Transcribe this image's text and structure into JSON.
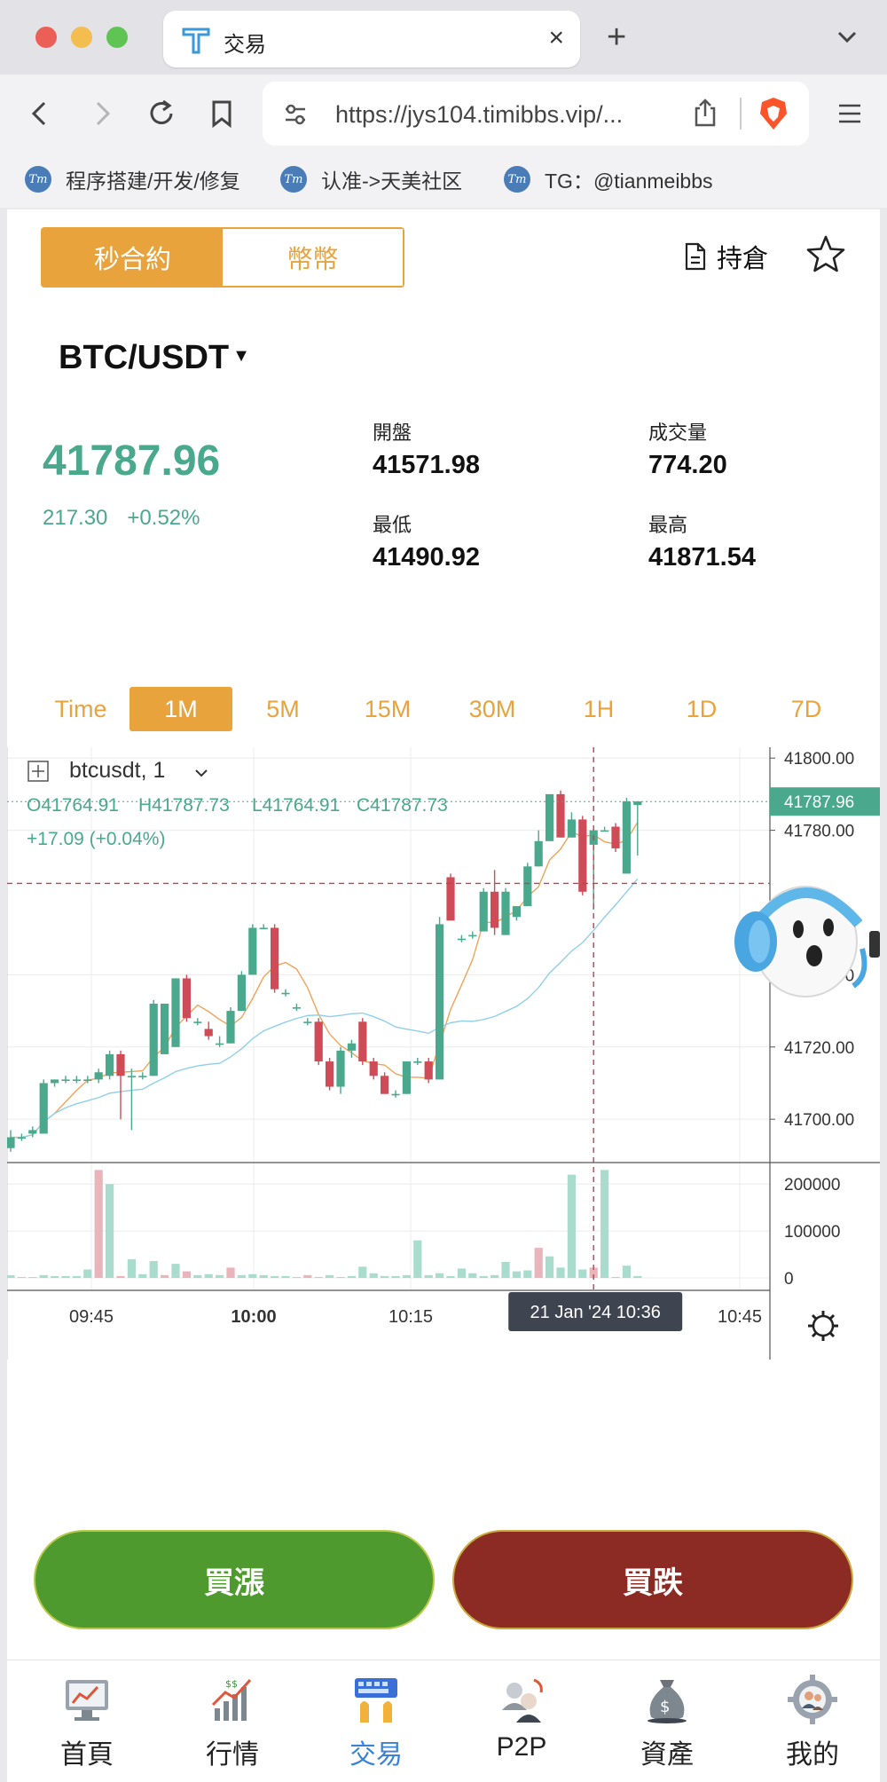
{
  "browser": {
    "tab_title": "交易",
    "url": "https://jys104.timibbs.vip/...",
    "bookmarks": [
      "程序搭建/开发/修复",
      "认准->天美社区",
      "TG：@tianmeibbs"
    ],
    "bookmark_logo": "Tm"
  },
  "header": {
    "segments": [
      "秒合約",
      "幣幣"
    ],
    "active_segment": "秒合約",
    "holdings_label": "持倉"
  },
  "ticker": {
    "pair": "BTC/USDT",
    "price": "41787.96",
    "change": "217.30",
    "change_pct": "+0.52%",
    "stats": [
      {
        "label": "開盤",
        "value": "41571.98"
      },
      {
        "label": "成交量",
        "value": "774.20"
      },
      {
        "label": "最低",
        "value": "41490.92"
      },
      {
        "label": "最高",
        "value": "41871.54"
      }
    ]
  },
  "timeframes": [
    "Time",
    "1M",
    "5M",
    "15M",
    "30M",
    "1H",
    "1D",
    "7D"
  ],
  "active_timeframe": "1M",
  "chart_legend": {
    "symbol": "btcusdt, 1",
    "o": "O41764.91",
    "h": "H41787.73",
    "l": "L41764.91",
    "c": "C41787.73",
    "change": "+17.09 (+0.04%)"
  },
  "chart_data": {
    "type": "candlestick",
    "symbol": "btcusdt",
    "interval": "1",
    "last_price": 41787.96,
    "price_axis": [
      "41800.00",
      "41780.00",
      "41740.00",
      "41720.00",
      "41700.00"
    ],
    "price_ylim": [
      41688,
      41803
    ],
    "volume_axis": [
      "200000",
      "100000",
      "0"
    ],
    "volume_ylim": [
      0,
      242000
    ],
    "time_axis": [
      "09:45",
      "10:00",
      "10:15",
      "10:45"
    ],
    "crosshair_label": "21 Jan '24   10:36",
    "colors": {
      "up": "#4aa88c",
      "down": "#cf4b57",
      "ma_fast": "#f0a25a",
      "ma_slow": "#8fd0e8"
    },
    "candles": [
      {
        "o": 41692,
        "h": 41697,
        "l": 41691,
        "c": 41695
      },
      {
        "o": 41695,
        "h": 41696,
        "l": 41694,
        "c": 41695
      },
      {
        "o": 41696,
        "h": 41698,
        "l": 41695,
        "c": 41697
      },
      {
        "o": 41696,
        "h": 41711,
        "l": 41696,
        "c": 41710
      },
      {
        "o": 41710,
        "h": 41711,
        "l": 41709,
        "c": 41711
      },
      {
        "o": 41711,
        "h": 41712,
        "l": 41710,
        "c": 41711
      },
      {
        "o": 41711,
        "h": 41712,
        "l": 41710,
        "c": 41711
      },
      {
        "o": 41711,
        "h": 41712,
        "l": 41710,
        "c": 41711
      },
      {
        "o": 41711,
        "h": 41714,
        "l": 41710,
        "c": 41713
      },
      {
        "o": 41712,
        "h": 41719,
        "l": 41711,
        "c": 41718
      },
      {
        "o": 41718,
        "h": 41719,
        "l": 41700,
        "c": 41712
      },
      {
        "o": 41712,
        "h": 41714,
        "l": 41697,
        "c": 41712
      },
      {
        "o": 41712,
        "h": 41713,
        "l": 41711,
        "c": 41712
      },
      {
        "o": 41712,
        "h": 41733,
        "l": 41712,
        "c": 41732
      },
      {
        "o": 41718,
        "h": 41732,
        "l": 41718,
        "c": 41732
      },
      {
        "o": 41720,
        "h": 41739,
        "l": 41720,
        "c": 41739
      },
      {
        "o": 41739,
        "h": 41740,
        "l": 41727,
        "c": 41728
      },
      {
        "o": 41727,
        "h": 41728,
        "l": 41726,
        "c": 41727
      },
      {
        "o": 41725,
        "h": 41727,
        "l": 41722,
        "c": 41723
      },
      {
        "o": 41721,
        "h": 41723,
        "l": 41720,
        "c": 41721
      },
      {
        "o": 41721,
        "h": 41731,
        "l": 41721,
        "c": 41730
      },
      {
        "o": 41730,
        "h": 41741,
        "l": 41730,
        "c": 41740
      },
      {
        "o": 41740,
        "h": 41754,
        "l": 41740,
        "c": 41753
      },
      {
        "o": 41753,
        "h": 41754,
        "l": 41753,
        "c": 41753
      },
      {
        "o": 41753,
        "h": 41754,
        "l": 41735,
        "c": 41736
      },
      {
        "o": 41735,
        "h": 41736,
        "l": 41734,
        "c": 41735
      },
      {
        "o": 41731,
        "h": 41732,
        "l": 41730,
        "c": 41731
      },
      {
        "o": 41727,
        "h": 41728,
        "l": 41726,
        "c": 41727
      },
      {
        "o": 41727,
        "h": 41728,
        "l": 41715,
        "c": 41716
      },
      {
        "o": 41716,
        "h": 41717,
        "l": 41708,
        "c": 41709
      },
      {
        "o": 41709,
        "h": 41720,
        "l": 41707,
        "c": 41719
      },
      {
        "o": 41719,
        "h": 41722,
        "l": 41717,
        "c": 41721
      },
      {
        "o": 41727,
        "h": 41728,
        "l": 41715,
        "c": 41716
      },
      {
        "o": 41716,
        "h": 41717,
        "l": 41711,
        "c": 41712
      },
      {
        "o": 41712,
        "h": 41713,
        "l": 41707,
        "c": 41707
      },
      {
        "o": 41707,
        "h": 41708,
        "l": 41706,
        "c": 41707
      },
      {
        "o": 41707,
        "h": 41716,
        "l": 41707,
        "c": 41716
      },
      {
        "o": 41716,
        "h": 41717,
        "l": 41715,
        "c": 41716
      },
      {
        "o": 41716,
        "h": 41717,
        "l": 41710,
        "c": 41711
      },
      {
        "o": 41711,
        "h": 41756,
        "l": 41711,
        "c": 41754
      },
      {
        "o": 41767,
        "h": 41768,
        "l": 41756,
        "c": 41755
      },
      {
        "o": 41750,
        "h": 41751,
        "l": 41749,
        "c": 41750
      },
      {
        "o": 41751,
        "h": 41752,
        "l": 41750,
        "c": 41751
      },
      {
        "o": 41752,
        "h": 41764,
        "l": 41752,
        "c": 41763
      },
      {
        "o": 41763,
        "h": 41769,
        "l": 41751,
        "c": 41753
      },
      {
        "o": 41751,
        "h": 41764,
        "l": 41751,
        "c": 41763
      },
      {
        "o": 41756,
        "h": 41759,
        "l": 41755,
        "c": 41759
      },
      {
        "o": 41759,
        "h": 41771,
        "l": 41759,
        "c": 41770
      },
      {
        "o": 41770,
        "h": 41780,
        "l": 41770,
        "c": 41777
      },
      {
        "o": 41777,
        "h": 41790,
        "l": 41777,
        "c": 41790
      },
      {
        "o": 41790,
        "h": 41791,
        "l": 41778,
        "c": 41778
      },
      {
        "o": 41778,
        "h": 41785,
        "l": 41778,
        "c": 41783
      },
      {
        "o": 41783,
        "h": 41784,
        "l": 41762,
        "c": 41763
      },
      {
        "o": 41776,
        "h": 41780,
        "l": 41758,
        "c": 41780
      },
      {
        "o": 41780,
        "h": 41781,
        "l": 41780,
        "c": 41780
      },
      {
        "o": 41781,
        "h": 41782,
        "l": 41774,
        "c": 41775
      },
      {
        "o": 41768,
        "h": 41789,
        "l": 41768,
        "c": 41788
      },
      {
        "o": 41787,
        "h": 41788,
        "l": 41773,
        "c": 41788
      }
    ],
    "volumes": [
      {
        "v": 6000,
        "up": true
      },
      {
        "v": 2000,
        "up": true
      },
      {
        "v": 2000,
        "up": true
      },
      {
        "v": 6000,
        "up": true
      },
      {
        "v": 4000,
        "up": true
      },
      {
        "v": 4000,
        "up": true
      },
      {
        "v": 4000,
        "up": true
      },
      {
        "v": 18000,
        "up": true
      },
      {
        "v": 230000,
        "up": false
      },
      {
        "v": 200000,
        "up": true
      },
      {
        "v": 4000,
        "up": false
      },
      {
        "v": 40000,
        "up": true
      },
      {
        "v": 8000,
        "up": true
      },
      {
        "v": 36000,
        "up": true
      },
      {
        "v": 6000,
        "up": false
      },
      {
        "v": 30000,
        "up": true
      },
      {
        "v": 14000,
        "up": false
      },
      {
        "v": 6000,
        "up": true
      },
      {
        "v": 8000,
        "up": true
      },
      {
        "v": 6000,
        "up": true
      },
      {
        "v": 22000,
        "up": false
      },
      {
        "v": 6000,
        "up": true
      },
      {
        "v": 8000,
        "up": true
      },
      {
        "v": 6000,
        "up": true
      },
      {
        "v": 4000,
        "up": true
      },
      {
        "v": 4000,
        "up": true
      },
      {
        "v": 2000,
        "up": true
      },
      {
        "v": 6000,
        "up": false
      },
      {
        "v": 2000,
        "up": true
      },
      {
        "v": 6000,
        "up": true
      },
      {
        "v": 2000,
        "up": true
      },
      {
        "v": 4000,
        "up": true
      },
      {
        "v": 24000,
        "up": true
      },
      {
        "v": 10000,
        "up": true
      },
      {
        "v": 4000,
        "up": true
      },
      {
        "v": 4000,
        "up": true
      },
      {
        "v": 6000,
        "up": true
      },
      {
        "v": 80000,
        "up": true
      },
      {
        "v": 6000,
        "up": true
      },
      {
        "v": 10000,
        "up": true
      },
      {
        "v": 4000,
        "up": true
      },
      {
        "v": 20000,
        "up": true
      },
      {
        "v": 10000,
        "up": true
      },
      {
        "v": 4000,
        "up": true
      },
      {
        "v": 6000,
        "up": true
      },
      {
        "v": 34000,
        "up": true
      },
      {
        "v": 14000,
        "up": true
      },
      {
        "v": 16000,
        "up": true
      },
      {
        "v": 64000,
        "up": false
      },
      {
        "v": 46000,
        "up": true
      },
      {
        "v": 22000,
        "up": true
      },
      {
        "v": 220000,
        "up": true
      },
      {
        "v": 18000,
        "up": true
      },
      {
        "v": 22000,
        "up": false
      },
      {
        "v": 230000,
        "up": true
      },
      {
        "v": 2000,
        "up": true
      },
      {
        "v": 26000,
        "up": true
      },
      {
        "v": 4000,
        "up": true
      }
    ]
  },
  "actions": {
    "buy_up": "買漲",
    "buy_down": "買跌"
  },
  "bottom_nav": [
    "首頁",
    "行情",
    "交易",
    "P2P",
    "資產",
    "我的"
  ],
  "active_nav": "交易"
}
